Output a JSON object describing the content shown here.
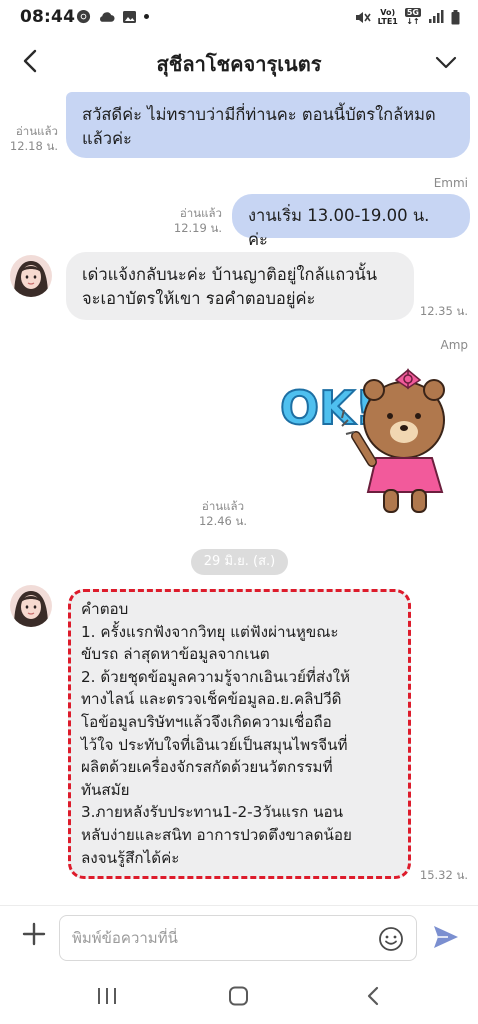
{
  "status": {
    "time": "08:44",
    "net_top": "Vo)",
    "net_mid": "LTE1",
    "net_5g": "5G"
  },
  "header": {
    "title": "สุชีลาโชคจารุเนตร"
  },
  "messages": {
    "m1": {
      "text": "สวัสดีค่ะ ไม่ทราบว่ามีกี่ท่านคะ ตอนนี้บัตรใกล้หมดแล้วค่ะ",
      "read": "อ่านแล้ว",
      "time": "12.18 น."
    },
    "m2": {
      "sender": "Emmi",
      "text": "งานเริ่ม 13.00-19.00 น. ค่ะ",
      "read": "อ่านแล้ว",
      "time": "12.19 น."
    },
    "m3": {
      "text": "เด่วแจ้งกลับนะค่ะ บ้านญาติอยู่ใกล้แถวนั้น จะเอาบัตรให้เขา รอคำตอบอยู่ค่ะ",
      "time": "12.35 น."
    },
    "m4": {
      "sender": "Amp",
      "sticker_text": "OK!",
      "read": "อ่านแล้ว",
      "time": "12.46 น."
    },
    "date": "29 มิ.ย. (ส.)",
    "m5": {
      "lines": [
        "คำตอบ",
        "1. ครั้งแรกฟังจากวิทยุ แต่ฟังผ่านหูขณะ",
        "ขับรถ ล่าสุดหาข้อมูลจากเนต",
        "2. ด้วยชุดข้อมูลความรู้จากเอินเวย์ที่ส่งให้",
        "ทางไลน์ และตรวจเช็คข้อมูลอ.ย.คลิปวีดิ",
        "โอข้อมูลบริษัทฯแล้วจึงเกิดความเชื่อถือ",
        "ไว้ใจ ประทับใจที่เอินเวย์เป็นสมุนไพรจีนที่",
        "ผลิตด้วยเครื่องจักรสกัดด้วยนวัตกรรมที่",
        "ทันสมัย",
        "3.ภายหลังรับประทาน1-2-3วันแรก นอน",
        "หลับง่ายและสนิท อาการปวดตึงขาลดน้อย",
        "ลงจนรู้สึกได้ค่ะ"
      ],
      "time": "15.32 น."
    }
  },
  "input": {
    "placeholder": "พิมพ์ข้อความที่นี่"
  },
  "colors": {
    "sent": "#c7d5f3",
    "received": "#eeeeef",
    "highlight": "#dd1b2b",
    "send_icon": "#7b8fd0"
  }
}
